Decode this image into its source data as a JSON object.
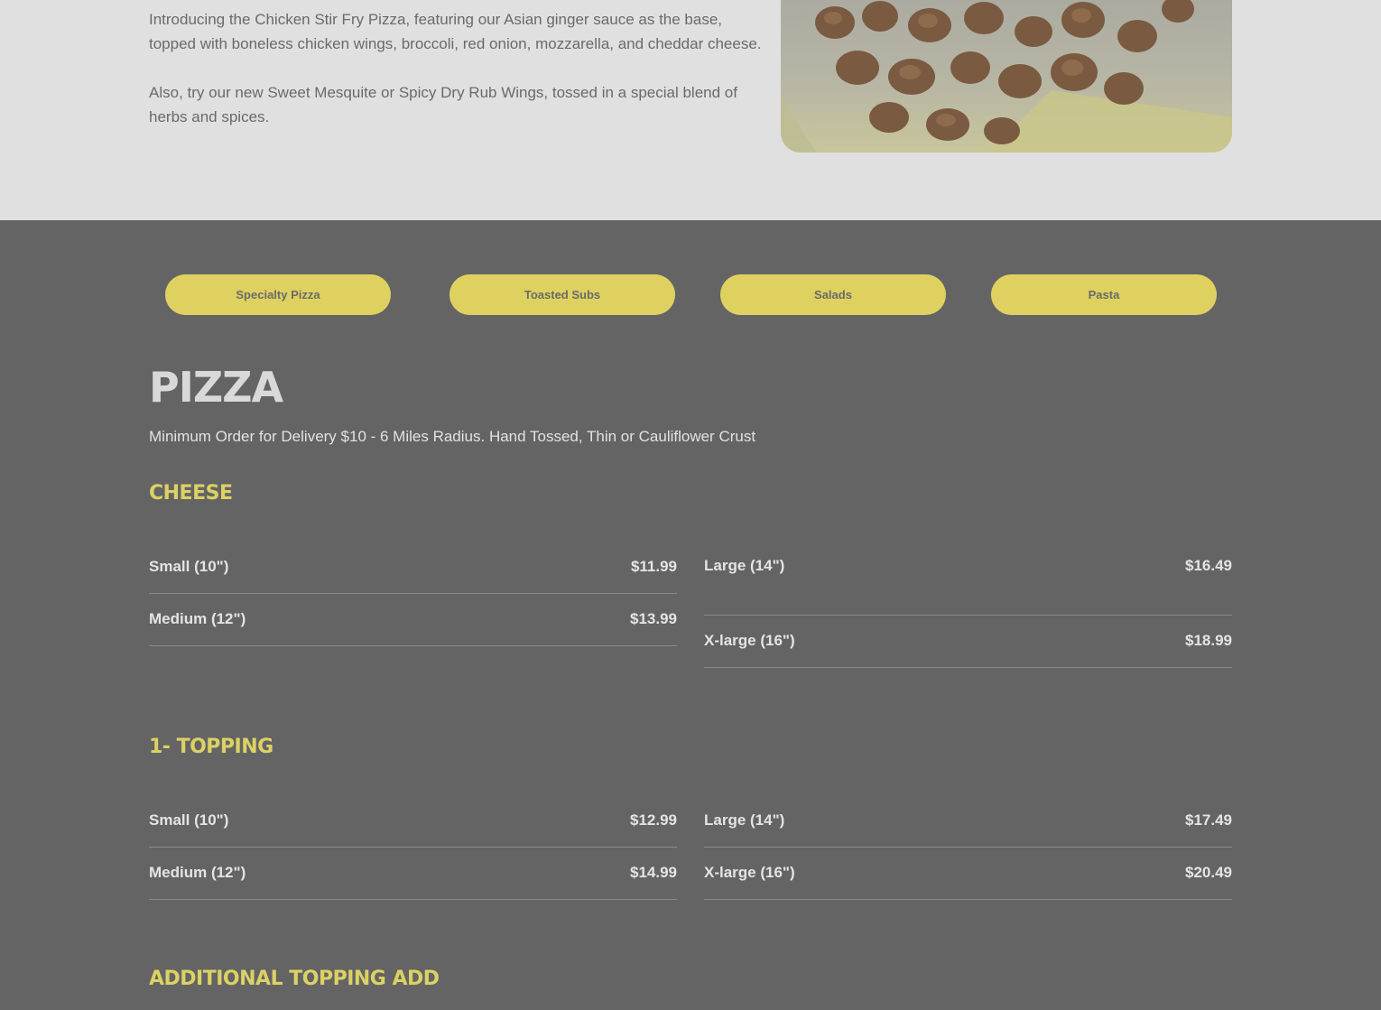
{
  "promo": {
    "paragraphs": [
      "Introducing the Chicken Stir Fry Pizza, featuring our Asian ginger sauce as the base, topped with boneless chicken wings, broccoli, red onion, mozzarella, and cheddar cheese.",
      "Also, try our new Sweet Mesquite or Spicy Dry Rub Wings, tossed in a special blend of herbs and spices."
    ]
  },
  "tabs": [
    {
      "label": "Specialty Pizza"
    },
    {
      "label": "Toasted Subs"
    },
    {
      "label": "Salads"
    },
    {
      "label": "Pasta"
    }
  ],
  "menu": {
    "title": "PIZZA",
    "subtitle": "Minimum Order for Delivery $10 - 6 Miles Radius. Hand Tossed, Thin or Cauliflower Crust",
    "sections": [
      {
        "heading": "CHEESE",
        "items": [
          {
            "label": "Small (10\")",
            "price": "$11.99"
          },
          {
            "label": "Medium (12\")",
            "price": "$13.99"
          },
          {
            "label": "Large (14\")",
            "price": "$16.49"
          },
          {
            "label": "X-large (16\")",
            "price": "$18.99"
          }
        ]
      },
      {
        "heading": "1- TOPPING",
        "items": [
          {
            "label": "Small (10\")",
            "price": "$12.99"
          },
          {
            "label": "Medium (12\")",
            "price": "$14.99"
          },
          {
            "label": "Large (14\")",
            "price": "$17.49"
          },
          {
            "label": "X-large (16\")",
            "price": "$20.49"
          }
        ]
      },
      {
        "heading": "ADDITIONAL TOPPING ADD"
      }
    ]
  },
  "colors": {
    "accent_yellow": "#dfd160",
    "dark_bg": "#646464",
    "light_bg": "#e0e0e0"
  }
}
